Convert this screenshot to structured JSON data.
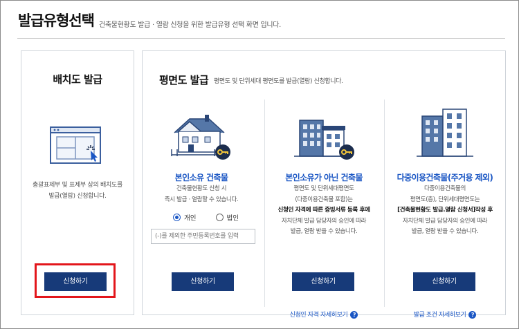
{
  "header": {
    "title": "발급유형선택",
    "subtitle": "건축물현황도 발급 · 열람 신청을 위한 발급유형 선택 화면 입니다."
  },
  "site_plan": {
    "title": "배치도 발급",
    "desc_line1": "총괄표제부 및 표제부 상의 배치도를",
    "desc_line2": "발급(열람) 신청합니다.",
    "apply_label": "신청하기"
  },
  "floor_plan": {
    "title": "평면도 발급",
    "subtitle": "평면도 및 단위세대 평면도를 발급(열람) 신청합니다.",
    "owner": {
      "title": "본인소유 건축물",
      "desc_line1": "건축물현황도 신청 시",
      "desc_line2": "즉시 발급 · 열람할 수 있습니다.",
      "radio_individual": "개인",
      "radio_corporate": "법인",
      "id_placeholder": "(-)를 제외한 주민등록번호를 입력",
      "apply_label": "신청하기"
    },
    "non_owner": {
      "title": "본인소유가 아닌 건축물",
      "desc_line1": "평면도 및 단위세대평면도",
      "desc_line2": "(다중이용건축물 포함)는",
      "desc_line3": "신청인 자격에 따른 증빙서류 등록 후에",
      "desc_line4": "자치단체 발급 담당자의 승인에 따라",
      "desc_line5": "발급, 열람 받을 수 있습니다.",
      "detail_link": "신청인 자격 자세히보기",
      "apply_label": "신청하기"
    },
    "multi_use": {
      "title": "다중이용건축물(주거용 제외)",
      "desc_line1": "다중이용건축물의",
      "desc_line2": "평면도(층), 단위세대평면도는",
      "desc_line3": "[건축물현황도 발급.열람 신청서]작성 후",
      "desc_line4": "자치단체 발급 담당자의 승인에 따라",
      "desc_line5": "발급, 열람 받을 수 있습니다.",
      "detail_link": "발급 조건 자세히보기",
      "apply_label": "신청하기"
    },
    "help_icon_glyph": "?"
  },
  "colors": {
    "accent_blue": "#1a56c4",
    "button_navy": "#173a79",
    "highlight_red": "#e3161b"
  },
  "icons": [
    "site-plan-window-icon",
    "house-key-icon",
    "buildings-key-icon",
    "tall-buildings-icon",
    "question-icon"
  ]
}
